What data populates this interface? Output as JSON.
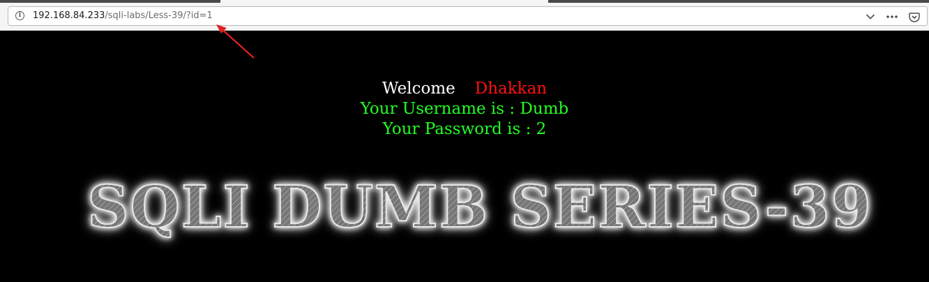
{
  "browser": {
    "url_host": "192.168.84.233",
    "url_path": "/sqli-labs/Less-39/?id=1",
    "icons": [
      "info-icon",
      "chevron-down-icon",
      "more-icon",
      "pocket-icon"
    ],
    "annotation_color": "#e02020"
  },
  "page": {
    "welcome_word": "Welcome",
    "welcome_name": "Dhakkan",
    "username_line": "Your Username is : Dumb",
    "password_line": "Your Password is : 2",
    "banner": "SQLI DUMB SERIES-39"
  },
  "colors": {
    "background": "#000000",
    "welcome": "#ffffff",
    "name": "#ff1111",
    "credentials": "#22ff22"
  }
}
